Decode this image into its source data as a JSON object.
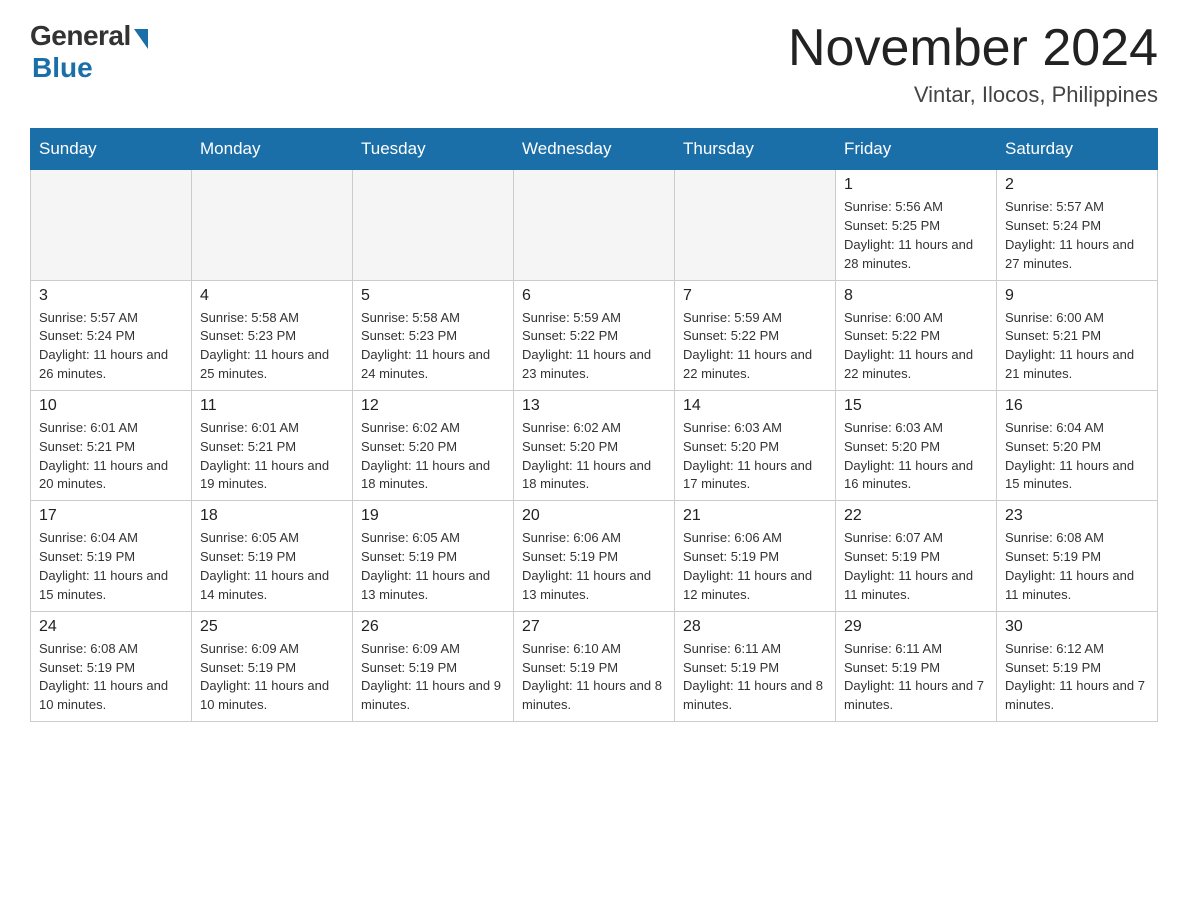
{
  "header": {
    "logo_general": "General",
    "logo_blue": "Blue",
    "month_year": "November 2024",
    "location": "Vintar, Ilocos, Philippines"
  },
  "days_of_week": [
    "Sunday",
    "Monday",
    "Tuesday",
    "Wednesday",
    "Thursday",
    "Friday",
    "Saturday"
  ],
  "weeks": [
    [
      {
        "day": "",
        "info": ""
      },
      {
        "day": "",
        "info": ""
      },
      {
        "day": "",
        "info": ""
      },
      {
        "day": "",
        "info": ""
      },
      {
        "day": "",
        "info": ""
      },
      {
        "day": "1",
        "info": "Sunrise: 5:56 AM\nSunset: 5:25 PM\nDaylight: 11 hours and 28 minutes."
      },
      {
        "day": "2",
        "info": "Sunrise: 5:57 AM\nSunset: 5:24 PM\nDaylight: 11 hours and 27 minutes."
      }
    ],
    [
      {
        "day": "3",
        "info": "Sunrise: 5:57 AM\nSunset: 5:24 PM\nDaylight: 11 hours and 26 minutes."
      },
      {
        "day": "4",
        "info": "Sunrise: 5:58 AM\nSunset: 5:23 PM\nDaylight: 11 hours and 25 minutes."
      },
      {
        "day": "5",
        "info": "Sunrise: 5:58 AM\nSunset: 5:23 PM\nDaylight: 11 hours and 24 minutes."
      },
      {
        "day": "6",
        "info": "Sunrise: 5:59 AM\nSunset: 5:22 PM\nDaylight: 11 hours and 23 minutes."
      },
      {
        "day": "7",
        "info": "Sunrise: 5:59 AM\nSunset: 5:22 PM\nDaylight: 11 hours and 22 minutes."
      },
      {
        "day": "8",
        "info": "Sunrise: 6:00 AM\nSunset: 5:22 PM\nDaylight: 11 hours and 22 minutes."
      },
      {
        "day": "9",
        "info": "Sunrise: 6:00 AM\nSunset: 5:21 PM\nDaylight: 11 hours and 21 minutes."
      }
    ],
    [
      {
        "day": "10",
        "info": "Sunrise: 6:01 AM\nSunset: 5:21 PM\nDaylight: 11 hours and 20 minutes."
      },
      {
        "day": "11",
        "info": "Sunrise: 6:01 AM\nSunset: 5:21 PM\nDaylight: 11 hours and 19 minutes."
      },
      {
        "day": "12",
        "info": "Sunrise: 6:02 AM\nSunset: 5:20 PM\nDaylight: 11 hours and 18 minutes."
      },
      {
        "day": "13",
        "info": "Sunrise: 6:02 AM\nSunset: 5:20 PM\nDaylight: 11 hours and 18 minutes."
      },
      {
        "day": "14",
        "info": "Sunrise: 6:03 AM\nSunset: 5:20 PM\nDaylight: 11 hours and 17 minutes."
      },
      {
        "day": "15",
        "info": "Sunrise: 6:03 AM\nSunset: 5:20 PM\nDaylight: 11 hours and 16 minutes."
      },
      {
        "day": "16",
        "info": "Sunrise: 6:04 AM\nSunset: 5:20 PM\nDaylight: 11 hours and 15 minutes."
      }
    ],
    [
      {
        "day": "17",
        "info": "Sunrise: 6:04 AM\nSunset: 5:19 PM\nDaylight: 11 hours and 15 minutes."
      },
      {
        "day": "18",
        "info": "Sunrise: 6:05 AM\nSunset: 5:19 PM\nDaylight: 11 hours and 14 minutes."
      },
      {
        "day": "19",
        "info": "Sunrise: 6:05 AM\nSunset: 5:19 PM\nDaylight: 11 hours and 13 minutes."
      },
      {
        "day": "20",
        "info": "Sunrise: 6:06 AM\nSunset: 5:19 PM\nDaylight: 11 hours and 13 minutes."
      },
      {
        "day": "21",
        "info": "Sunrise: 6:06 AM\nSunset: 5:19 PM\nDaylight: 11 hours and 12 minutes."
      },
      {
        "day": "22",
        "info": "Sunrise: 6:07 AM\nSunset: 5:19 PM\nDaylight: 11 hours and 11 minutes."
      },
      {
        "day": "23",
        "info": "Sunrise: 6:08 AM\nSunset: 5:19 PM\nDaylight: 11 hours and 11 minutes."
      }
    ],
    [
      {
        "day": "24",
        "info": "Sunrise: 6:08 AM\nSunset: 5:19 PM\nDaylight: 11 hours and 10 minutes."
      },
      {
        "day": "25",
        "info": "Sunrise: 6:09 AM\nSunset: 5:19 PM\nDaylight: 11 hours and 10 minutes."
      },
      {
        "day": "26",
        "info": "Sunrise: 6:09 AM\nSunset: 5:19 PM\nDaylight: 11 hours and 9 minutes."
      },
      {
        "day": "27",
        "info": "Sunrise: 6:10 AM\nSunset: 5:19 PM\nDaylight: 11 hours and 8 minutes."
      },
      {
        "day": "28",
        "info": "Sunrise: 6:11 AM\nSunset: 5:19 PM\nDaylight: 11 hours and 8 minutes."
      },
      {
        "day": "29",
        "info": "Sunrise: 6:11 AM\nSunset: 5:19 PM\nDaylight: 11 hours and 7 minutes."
      },
      {
        "day": "30",
        "info": "Sunrise: 6:12 AM\nSunset: 5:19 PM\nDaylight: 11 hours and 7 minutes."
      }
    ]
  ]
}
